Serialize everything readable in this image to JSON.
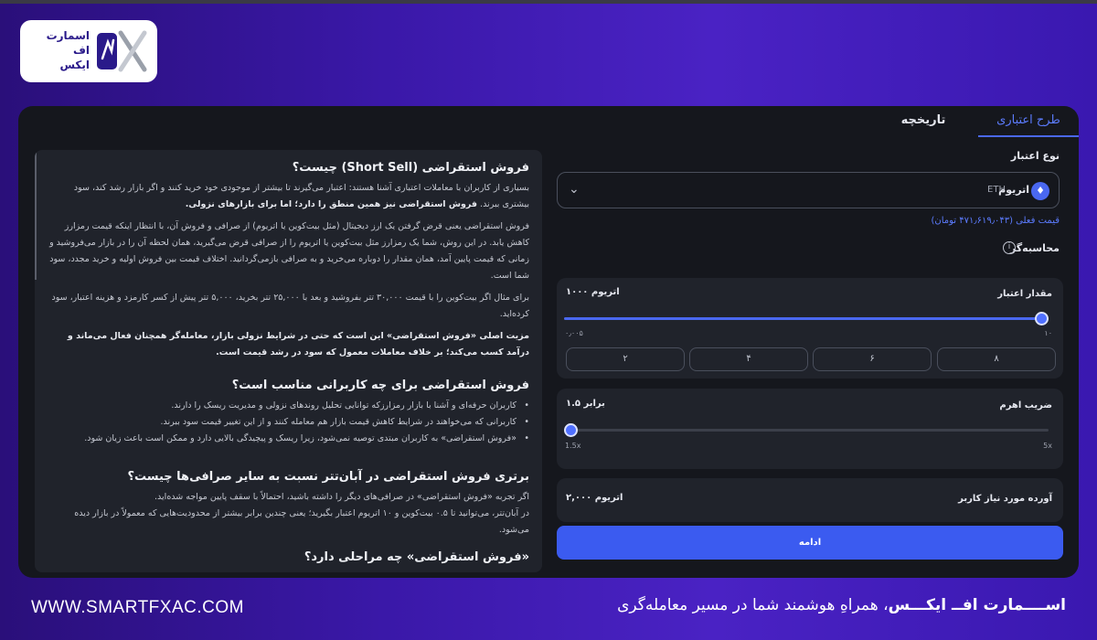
{
  "brand": {
    "logo_lines": [
      "اسمارت",
      "اف",
      "ایکس"
    ],
    "website": "WWW.SMARTFXAC.COM",
    "tagline_brand": "اســــمارت افــ ایکـــس",
    "tagline_rest": "، همراهِ هوشمند شما در مسیر معامله‌گری"
  },
  "tabs": [
    {
      "label": "طرح اعتباری",
      "active": true
    },
    {
      "label": "تاریخچه",
      "active": false
    }
  ],
  "credit_panel": {
    "credit_type_label": "نوع اعتبار",
    "asset_name": "اتریوم",
    "asset_code": "ETH",
    "current_price": "قیمت فعلی (۴۷۱٫۶۱۹٫۰۴۳ تومان)",
    "calculator_label": "محاسبه‌گر",
    "credit_amount_label": "مقدار اعتبار",
    "credit_amount_value": "۱۰۰۰ اتریوم",
    "credit_slider": {
      "min_label": "۰٫۰۰۵",
      "max_label": "۱۰",
      "fraction": 1.0
    },
    "presets": [
      "۸",
      "۶",
      "۴",
      "۲"
    ],
    "leverage_label": "ضریب اهرم",
    "leverage_value": "۱.۵ برابر",
    "leverage_slider": {
      "min_label": "1.5x",
      "max_label": "5x",
      "fraction": 0.0
    },
    "required_deposit_label": "آورده مورد نیاز کاربر",
    "required_deposit_value": "۲,۰۰۰ اتریوم",
    "continue_label": "ادامه",
    "accent_color": "#3b5bf0"
  },
  "article": {
    "h1": "فروش استقراضی (Short Sell) چیست؟",
    "p1": "بسیاری از کاربران با معاملات اعتباری آشنا هستند: اعتبار می‌گیرند تا بیشتر از موجودی خود خرید کنند و اگر بازار رشد کند، سود بیشتری ببرند.",
    "p1_bold": "فروش استقراضی نیز همین منطق را دارد؛ اما برای بازارهای نزولی.",
    "p2": "فروش استقراضی یعنی قرض گرفتن یک ارز دیجیتال (مثل بیت‌کوین یا اتریوم) از صرافی و فروش آن، با انتظار اینکه قیمت رمزارز کاهش یابد. در این روش، شما یک رمزارز مثل بیت‌کوین یا اتریوم را از صرافی قرض می‌گیرید، همان لحظه آن را در بازار می‌فروشید و زمانی که قیمت پایین آمد، همان مقدار را دوباره می‌خرید و به صرافی بازمی‌گردانید. اختلاف قیمت بین فروش اولیه و خرید مجدد، سود شما است.",
    "p3": "برای مثال اگر بیت‌کوین را با قیمت ۳۰,۰۰۰ تتر بفروشید و بعد با ۲۵,۰۰۰ تتر بخرید، ۵,۰۰۰ تتر پیش از کسر کارمزد و هزینه اعتبار، سود کرده‌اید.",
    "p4_bold": "مزیت اصلی «فروش استقراضی» این است که حتی در شرایط نزولی بازار، معامله‌گر همچنان فعال می‌ماند و درآمد کسب می‌کند؛ بر خلاف معاملات معمول که سود در رشد قیمت است.",
    "h2": "فروش استقراضی برای چه کاربرانی مناسب است؟",
    "bullets": [
      "کاربران حرفه‌ای و آشنا با بازار رمزارزکه توانایی تحلیل روندهای نزولی و مدیریت ریسک را دارند.",
      "کاربرانی که می‌خواهند در شرایط کاهش قیمت بازار هم معامله کنند و از این تغییر قیمت سود ببرند.",
      "«فروش استقراضی» به کاربران مبتدی توصیه نمی‌شود، زیرا ریسک و پیچیدگی بالایی دارد و ممکن است باعث زیان شود."
    ],
    "h3": "برتری فروش استقراضی در آبان‌تتر نسبت به سایر صرافی‌ها چیست؟",
    "p5": "اگر تجربه «فروش استقراضی» در صرافی‌های دیگر را داشته باشید، احتمالاً با سقف پایین مواجه شده‌اید.",
    "p6": "در آبان‌تتر، می‌توانید تا ۰.۵ بیت‌کوین و ۱۰ اتریوم اعتبار بگیرید؛ یعنی چندین برابر بیشتر از محدودیت‌هایی که معمولاً در بازار دیده می‌شود.",
    "h4": "«فروش استقراضی» چه مراحلی دارد؟"
  }
}
